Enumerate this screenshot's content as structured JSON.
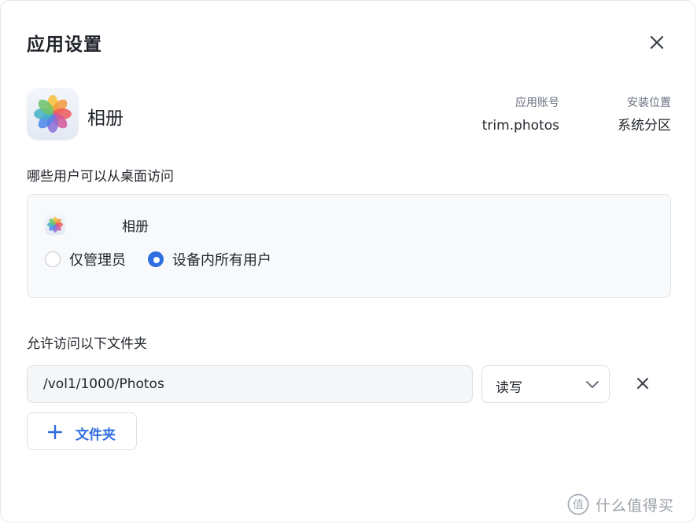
{
  "dialog": {
    "title": "应用设置"
  },
  "app": {
    "name": "相册",
    "account_label": "应用账号",
    "account_value": "trim.photos",
    "location_label": "安装位置",
    "location_value": "系统分区"
  },
  "access": {
    "section_label": "哪些用户可以从桌面访问",
    "card_app_name": "相册",
    "options": [
      {
        "label": "仅管理员",
        "checked": false
      },
      {
        "label": "设备内所有用户",
        "checked": true
      }
    ]
  },
  "folders": {
    "section_label": "允许访问以下文件夹",
    "path_value": "/vol1/1000/Photos",
    "permission_value": "读写",
    "add_button_label": "文件夹"
  },
  "watermark": {
    "text": "什么值得买"
  },
  "colors": {
    "accent": "#2f6ee0",
    "card_bg": "#f8f9fb",
    "border": "#dcdfe4"
  }
}
